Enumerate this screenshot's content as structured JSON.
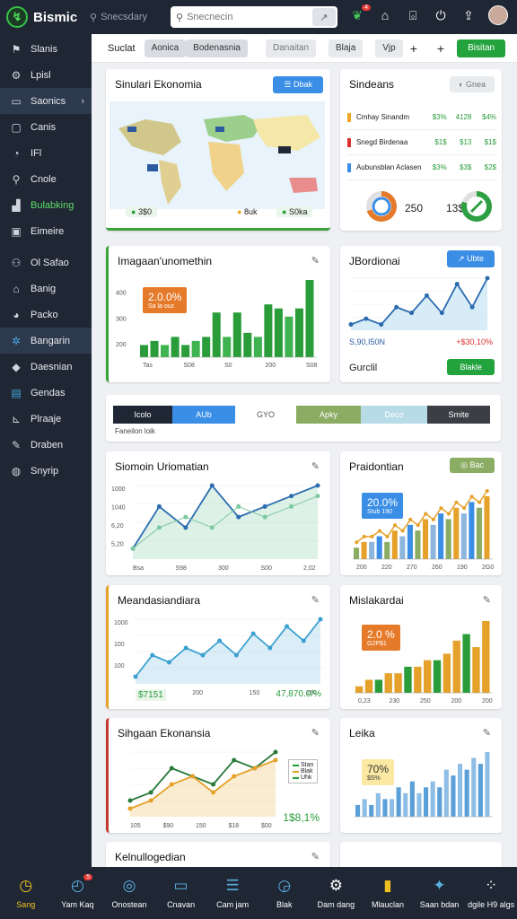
{
  "topbar": {
    "brand": "Bismic",
    "search_label": "Snecsdary",
    "search_placeholder": "Snecnecin",
    "notif_count": "4",
    "icons": [
      "leaf-icon",
      "bank-icon",
      "lock-icon",
      "power-icon",
      "share-icon"
    ]
  },
  "sidebar": {
    "items": [
      {
        "label": "Slanis",
        "icon": "flag-icon"
      },
      {
        "label": "Lpisl",
        "icon": "gear-icon"
      },
      {
        "label": "Saonics",
        "icon": "folder-icon",
        "chevron": true
      },
      {
        "label": "Canis",
        "icon": "doc-icon"
      },
      {
        "label": "IFl",
        "icon": "clock-icon"
      },
      {
        "label": "Cnole",
        "icon": "bulb-icon"
      },
      {
        "label": "Bulabking",
        "icon": "chart-icon"
      },
      {
        "label": "Eimeire",
        "icon": "image-icon"
      },
      {
        "label": "Ol Safao",
        "icon": "users-icon"
      },
      {
        "label": "Banig",
        "icon": "bank-icon"
      },
      {
        "label": "Packo",
        "icon": "pie-icon"
      },
      {
        "label": "Bangarin",
        "icon": "cog-icon"
      },
      {
        "label": "Daesnian",
        "icon": "tag-icon"
      },
      {
        "label": "Gendas",
        "icon": "layout-icon"
      },
      {
        "label": "Plraaje",
        "icon": "ruler-icon"
      },
      {
        "label": "Draben",
        "icon": "pen-icon"
      },
      {
        "label": "Snyrip",
        "icon": "globe-icon"
      }
    ]
  },
  "subbar": {
    "label": "Suclat",
    "chips": [
      "Aonica",
      "Bodenasnia",
      "Danaitan",
      "Blaja",
      "Vjp"
    ],
    "plus": "+",
    "cta": "Bisitan"
  },
  "cards": {
    "map": {
      "title": "Sinulari Ekonomia",
      "btn": "Dbak",
      "stat1": "3$0",
      "stat2": "8uk",
      "stat3": "S0ka"
    },
    "sindeans": {
      "title": "Sindeans",
      "btn": "Gnea",
      "rows": [
        {
          "name": "Cmhay Sinandm",
          "vals": [
            "$3%",
            "4128",
            "$4%"
          ],
          "color": "#f1a623"
        },
        {
          "name": "Snegd Birdenaa",
          "vals": [
            "$1$",
            "$13",
            "$1$"
          ],
          "color": "#d93030"
        },
        {
          "name": "Aubunsblan Aclasen",
          "vals": [
            "$3%",
            "$3$",
            "$2$"
          ],
          "color": "#3a8ee6"
        }
      ],
      "donut1": "250",
      "donut1_value": 0.7,
      "donut2": "13$",
      "donut2_value": 0.8
    },
    "imagean": {
      "title": "Imagaan'unomethin",
      "tag": "2.0.0%",
      "tag_sub": "Sa la ouz",
      "chart_data": {
        "type": "bar",
        "values": [
          3,
          4,
          3,
          5,
          3,
          4,
          5,
          11,
          5,
          11,
          6,
          5,
          13,
          12,
          10,
          12,
          19
        ],
        "ylabels": [
          "200",
          "300",
          "400"
        ],
        "xlabels": [
          "Tas",
          "S08",
          "S0",
          "200",
          "S08"
        ]
      }
    },
    "jbordionai": {
      "title": "JBordionai",
      "btn": "Ubte",
      "lbl1": "S,90,I50N",
      "lbl2": "+$30,10%",
      "footer": "Gurclil",
      "cta": "Blakle",
      "chart_data": {
        "type": "line",
        "values": [
          2,
          3,
          2,
          5,
          4,
          7,
          4,
          9,
          5,
          10
        ]
      }
    },
    "segbar": {
      "segments": [
        "Icolo",
        "AUb",
        "GYO",
        "Apky",
        "Deco",
        "Smite"
      ],
      "caption": "Faneilon loik"
    },
    "siomoin": {
      "title": "Siomoin Uriomatian",
      "chart_data": {
        "type": "line",
        "series": [
          {
            "name": "a",
            "values": [
              1,
              5,
              3,
              7,
              4,
              5,
              6,
              7
            ]
          },
          {
            "name": "b",
            "values": [
              1,
              3,
              4,
              3,
              5,
              4,
              5,
              6
            ]
          }
        ],
        "ylabels": [
          "1000",
          "1040",
          "6,20",
          "5,20"
        ],
        "xlabels": [
          "Bsa",
          "S98",
          "300",
          "S00",
          "2,02"
        ]
      }
    },
    "praidontian": {
      "title": "Praidontian",
      "btn": "Bac",
      "tag": "20.0%",
      "tag_sub": "Stub 190",
      "chart_data": {
        "type": "bar",
        "values": [
          2,
          3,
          3,
          4,
          3,
          5,
          4,
          6,
          5,
          7,
          6,
          8,
          7,
          9,
          8,
          10,
          9,
          11
        ],
        "xlabels": [
          "200",
          "220",
          "270",
          "260",
          "190",
          "2G0"
        ]
      }
    },
    "meanda": {
      "title": "Meandasiandiara",
      "stat1": "$7151",
      "stat2": "47,870.0/%",
      "chart_data": {
        "type": "line",
        "values": [
          1,
          4,
          3,
          5,
          4,
          6,
          4,
          7,
          5,
          8,
          6,
          9
        ],
        "ylabels": [
          "1000",
          "100",
          "100"
        ],
        "xlabels": [
          "?",
          "200",
          "150",
          "150"
        ]
      }
    },
    "mislakardai": {
      "title": "Mislakardai",
      "tag": "2.0 %",
      "tag_sub": "G2P$1",
      "chart_data": {
        "type": "bar",
        "values": [
          1,
          2,
          2,
          3,
          3,
          4,
          4,
          5,
          5,
          6,
          8,
          9,
          7,
          11
        ],
        "xlabels": [
          "0,23",
          "230",
          "250",
          "200",
          "200"
        ]
      }
    },
    "sihgaan": {
      "title": "Sihgaan Ekonansia",
      "legend": [
        "Stan",
        "Blak",
        "Uhk"
      ],
      "stat": "1$8,1%",
      "chart_data": {
        "type": "area",
        "series": [
          {
            "name": "a",
            "values": [
              2,
              3,
              6,
              5,
              4,
              7,
              6,
              8
            ]
          },
          {
            "name": "b",
            "values": [
              1,
              2,
              4,
              5,
              3,
              5,
              6,
              7
            ]
          }
        ],
        "xlabels": [
          "105",
          "$90",
          "150",
          "$18",
          "$00"
        ]
      }
    },
    "leika": {
      "title": "Leika",
      "tag": "70%",
      "tag_sub": "$S%",
      "chart_data": {
        "type": "bar",
        "values": [
          2,
          3,
          2,
          4,
          3,
          3,
          5,
          4,
          6,
          4,
          5,
          6,
          5,
          8,
          7,
          9,
          8,
          10,
          9,
          11
        ]
      }
    },
    "kelnu": {
      "title": "Kelnullogedian"
    }
  },
  "bottombar": {
    "items": [
      {
        "label": "Sang",
        "icon": "clock-icon",
        "active": true
      },
      {
        "label": "Yam Kaq",
        "icon": "history-icon",
        "badge": "5"
      },
      {
        "label": "Onostean",
        "icon": "compass-icon"
      },
      {
        "label": "Cnavan",
        "icon": "monitor-icon"
      },
      {
        "label": "Cam jam",
        "icon": "list-icon"
      },
      {
        "label": "Blak",
        "icon": "timer-icon"
      },
      {
        "label": "Dam dang",
        "icon": "settings-icon"
      },
      {
        "label": "Mlauclan",
        "icon": "book-icon"
      },
      {
        "label": "Saan bdan",
        "icon": "pin-icon"
      },
      {
        "label": "dgile H9 algs",
        "icon": "grid-icon"
      }
    ]
  }
}
